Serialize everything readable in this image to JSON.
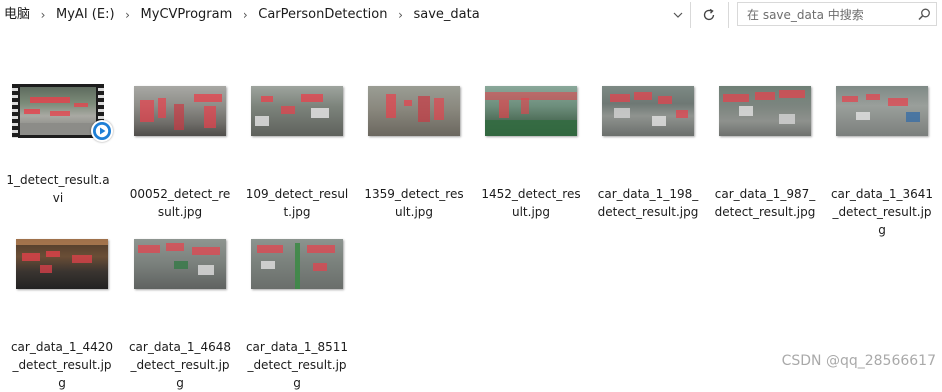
{
  "breadcrumb": [
    "电脑",
    "MyAI (E:)",
    "MyCVProgram",
    "CarPersonDetection",
    "save_data"
  ],
  "search": {
    "placeholder": "在 save_data 中搜索"
  },
  "files": [
    {
      "name": "1_detect_result.avi",
      "kind": "video"
    },
    {
      "name": "00052_detect_result.jpg",
      "kind": "image"
    },
    {
      "name": "109_detect_result.jpg",
      "kind": "image"
    },
    {
      "name": "1359_detect_result.jpg",
      "kind": "image"
    },
    {
      "name": "1452_detect_result.jpg",
      "kind": "image"
    },
    {
      "name": "car_data_1_198_detect_result.jpg",
      "kind": "image"
    },
    {
      "name": "car_data_1_987_detect_result.jpg",
      "kind": "image"
    },
    {
      "name": "car_data_1_3641_detect_result.jpg",
      "kind": "image"
    },
    {
      "name": "car_data_1_4420_detect_result.jpg",
      "kind": "image"
    },
    {
      "name": "car_data_1_4648_detect_result.jpg",
      "kind": "image"
    },
    {
      "name": "car_data_1_8511_detect_result.jpg",
      "kind": "image"
    }
  ],
  "watermark": "CSDN @qq_28566617"
}
